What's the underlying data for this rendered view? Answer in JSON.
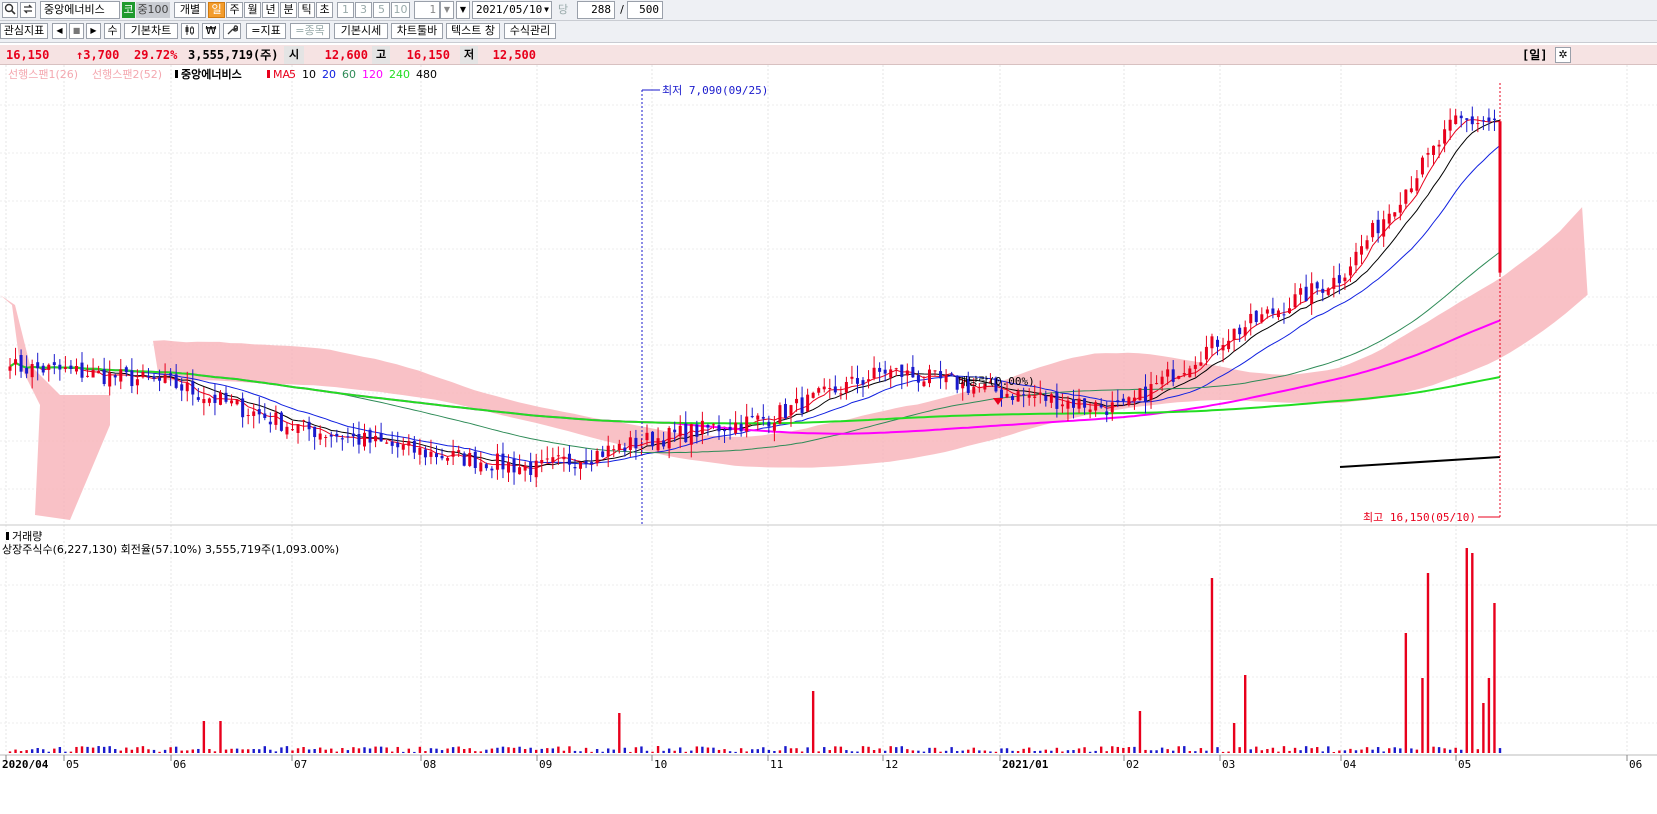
{
  "toolbar": {
    "stock_name": "중앙에너비스",
    "market_badge": "코",
    "index_badge": "중100",
    "individual_label": "개별",
    "periods": [
      "일",
      "주",
      "월",
      "년",
      "분",
      "틱",
      "초"
    ],
    "active_period": "일",
    "intervals": [
      "1",
      "3",
      "5",
      "10"
    ],
    "interval_value": "1",
    "date": "2021/05/10",
    "unit_label": "당",
    "count": "288",
    "slash": "/",
    "total": "500"
  },
  "toolbar2": {
    "interest_label": "관심지표",
    "prev": "◀",
    "stop": "■",
    "next": "▶",
    "edit": "수",
    "basic_chart": "기본차트",
    "won": "₩",
    "indicator": "=지표",
    "stock_compare": "=종목",
    "basic_quote": "기본시세",
    "chart_toolbar": "차트툴바",
    "text_window": "텍스트 창",
    "formula_mgmt": "수식관리"
  },
  "quote": {
    "price": "16,150",
    "change": "↑3,700",
    "change_pct": "29.72%",
    "volume": "3,555,719(주)",
    "open_label": "시",
    "open": "12,600",
    "high_label": "고",
    "high": "16,150",
    "low_label": "저",
    "low": "12,500",
    "period_tag": "[일]",
    "settings_icon": "gear-icon"
  },
  "legend": {
    "span1": "선행스팬1(26)",
    "span2": "선행스팬2(52)",
    "name": "중앙에너비스",
    "ma_label": "MA",
    "ma": [
      {
        "period": "5",
        "color": "#e8001c"
      },
      {
        "period": "10",
        "color": "#000000"
      },
      {
        "period": "20",
        "color": "#1020e0"
      },
      {
        "period": "60",
        "color": "#2e8b57"
      },
      {
        "period": "120",
        "color": "#ff00ff"
      },
      {
        "period": "240",
        "color": "#22dd22"
      },
      {
        "period": "480",
        "color": "#000000"
      }
    ]
  },
  "annotations": {
    "low": "최저 7,090(09/25)",
    "high": "최고 16,150(05/10)",
    "dividend": "배당락(0.00%)"
  },
  "volume_panel": {
    "title": "거래량",
    "info": "상장주식수(6,227,130) 회전율(57.10%) 3,555,719주(1,093.00%)"
  },
  "x_axis": [
    "2020/04",
    "05",
    "06",
    "07",
    "08",
    "09",
    "10",
    "11",
    "12",
    "2021/01",
    "02",
    "03",
    "04",
    "05",
    "06"
  ],
  "colors": {
    "up": "#e8001c",
    "down": "#1a1acc",
    "cloud": "#f7b2b8"
  },
  "chart_data": {
    "type": "candlestick",
    "price_range": [
      6800,
      17000
    ],
    "months": [
      "2020/04",
      "05",
      "06",
      "07",
      "08",
      "09",
      "10",
      "11",
      "12",
      "2021/01",
      "02",
      "03",
      "04",
      "05"
    ],
    "monthly_close": [
      10400,
      10300,
      10000,
      9000,
      8400,
      8000,
      8700,
      9200,
      10300,
      9800,
      9400,
      11000,
      12500,
      16150
    ],
    "last": {
      "date": "2021/05/10",
      "open": 12600,
      "high": 16150,
      "low": 12500,
      "close": 16150,
      "volume": 3555719
    },
    "extremes": {
      "low": {
        "date": "09/25",
        "value": 7090
      },
      "high": {
        "date": "05/10",
        "value": 16150
      }
    }
  }
}
